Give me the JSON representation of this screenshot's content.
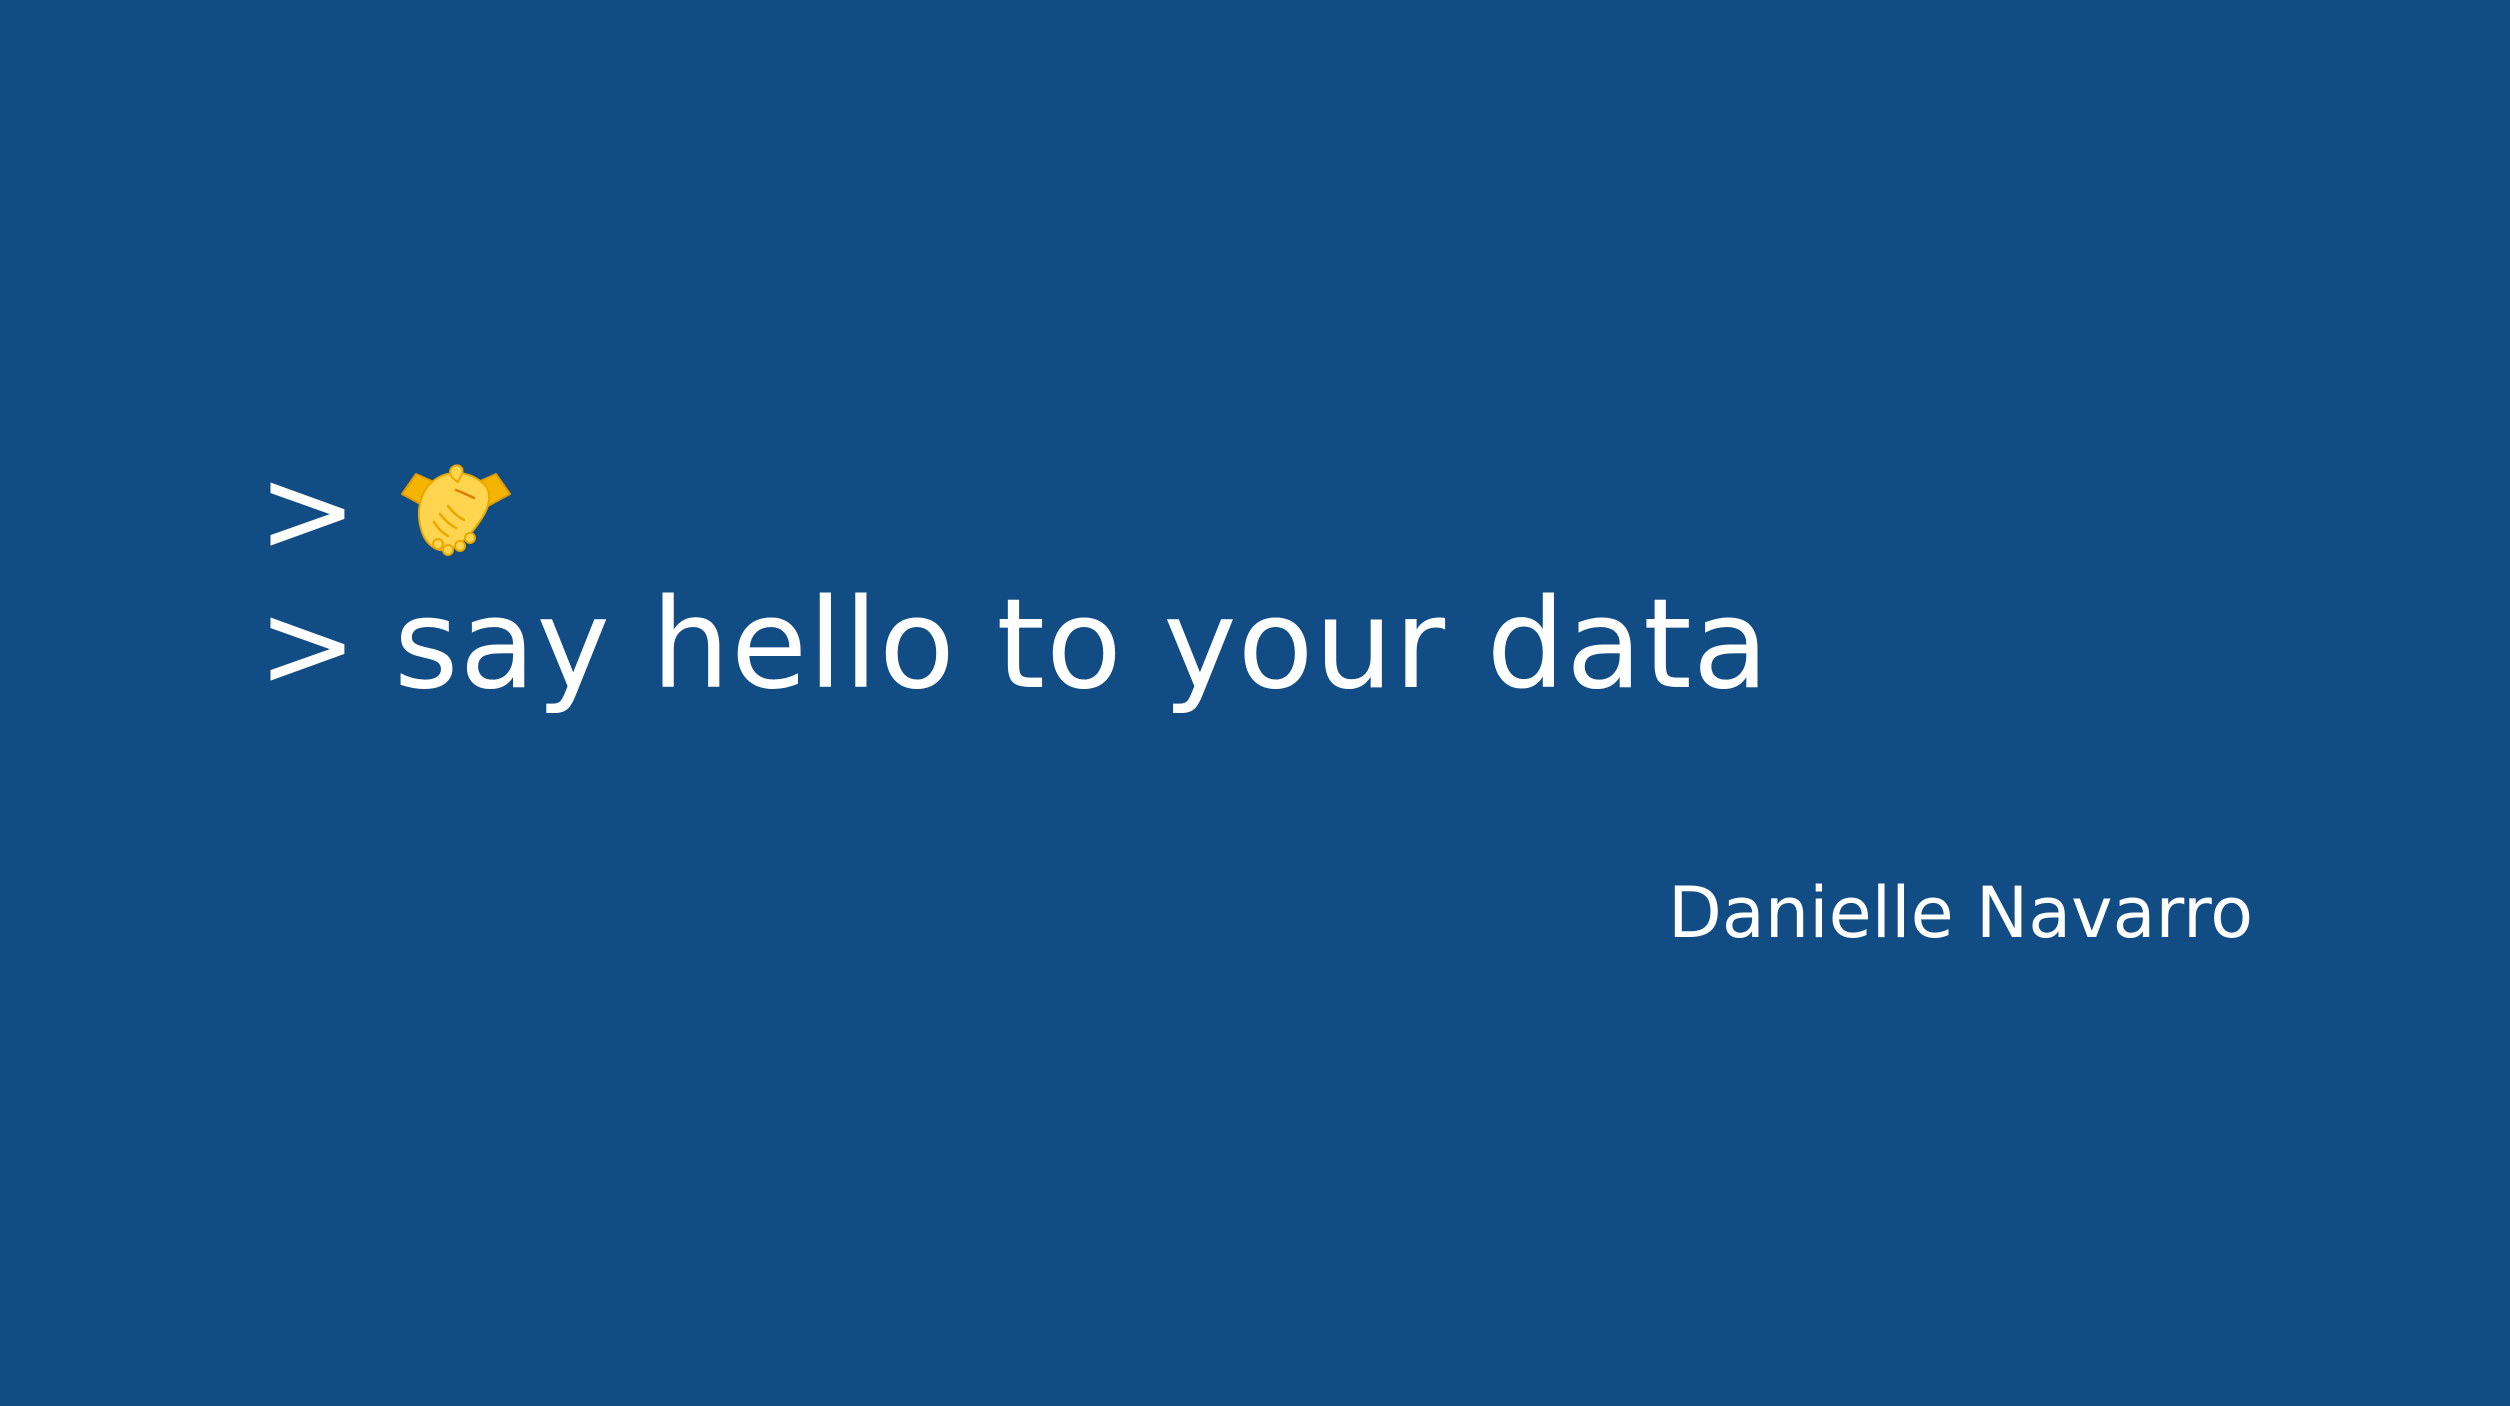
{
  "slide": {
    "background_color": "#114d84",
    "text_color": "#ffffff",
    "line1": {
      "prompt": ">",
      "icon": "handshake-icon"
    },
    "line2": {
      "prompt": ">",
      "text": "say hello to your data"
    },
    "author": "Danielle Navarro"
  }
}
